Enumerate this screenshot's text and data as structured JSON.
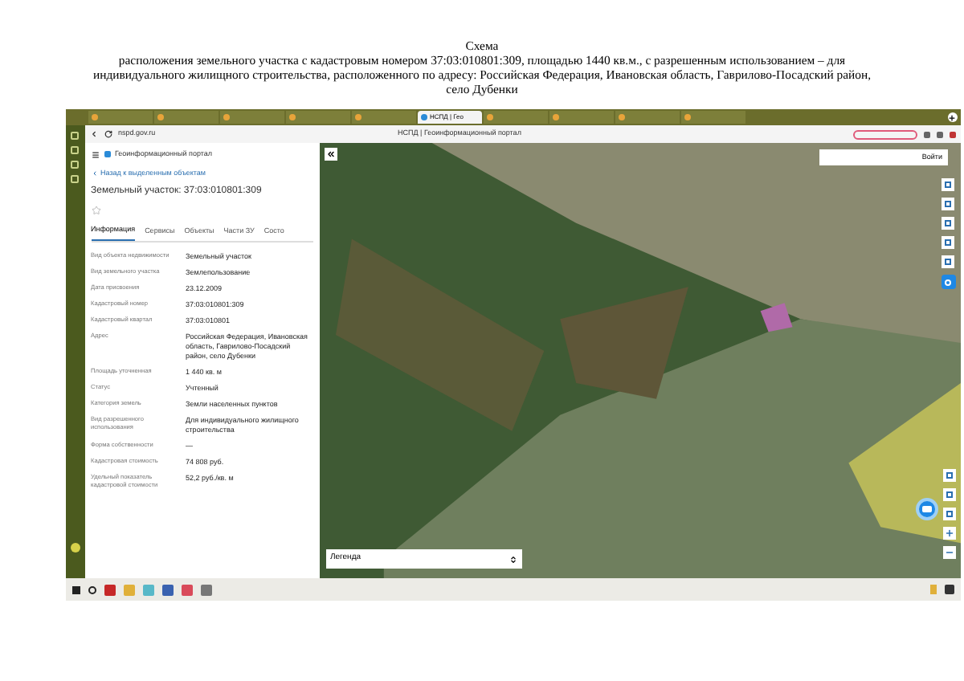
{
  "document": {
    "heading": "Схема",
    "caption": "расположения земельного участка с кадастровым номером 37:03:010801:309, площадью 1440 кв.м., с разрешенным использованием – для индивидуального жилищного строительства, расположенного по адресу: Российская Федерация, Ивановская область, Гаврилово-Посадский район,  село Дубенки"
  },
  "browser": {
    "tabs": [
      {
        "selected": false
      },
      {
        "selected": false
      },
      {
        "selected": false
      },
      {
        "selected": false
      },
      {
        "selected": false
      },
      {
        "label": "НСПД | Гео",
        "selected": true
      },
      {
        "selected": false
      },
      {
        "selected": false
      },
      {
        "selected": false
      },
      {
        "selected": false
      }
    ],
    "address": "nspd.gov.ru",
    "page_title": "НСПД | Геоинформационный портал"
  },
  "panel": {
    "portal": "Геоинформационный портал",
    "back_link": "Назад к выделенным объектам",
    "title": "Земельный участок: 37:03:010801:309",
    "tabs": [
      {
        "label": "Информация",
        "selected": true
      },
      {
        "label": "Сервисы",
        "selected": false
      },
      {
        "label": "Объекты",
        "selected": false
      },
      {
        "label": "Части ЗУ",
        "selected": false
      },
      {
        "label": "Состо",
        "selected": false
      }
    ],
    "rows": [
      {
        "label": "Вид объекта недвижимости",
        "value": "Земельный участок"
      },
      {
        "label": "Вид земельного участка",
        "value": "Землепользование"
      },
      {
        "label": "Дата присвоения",
        "value": "23.12.2009"
      },
      {
        "label": "Кадастровый номер",
        "value": "37:03:010801:309"
      },
      {
        "label": "Кадастровый квартал",
        "value": "37:03:010801"
      },
      {
        "label": "Адрес",
        "value": "Российская Федерация, Ивановская область, Гаврилово-Посадский район, село Дубенки"
      },
      {
        "label": "Площадь уточненная",
        "value": "1 440 кв. м"
      },
      {
        "label": "Статус",
        "value": "Учтенный"
      },
      {
        "label": "Категория земель",
        "value": "Земли населенных пунктов"
      },
      {
        "label": "Вид разрешенного использования",
        "value": "Для индивидуального жилищного строительства"
      },
      {
        "label": "Форма собственности",
        "value": "—"
      },
      {
        "label": "Кадастровая стоимость",
        "value": "74 808 руб."
      },
      {
        "label": "Удельный показатель кадастровой стоимости",
        "value": "52,2 руб./кв. м"
      }
    ]
  },
  "map": {
    "login": "Войти",
    "legend": "Легенда"
  }
}
